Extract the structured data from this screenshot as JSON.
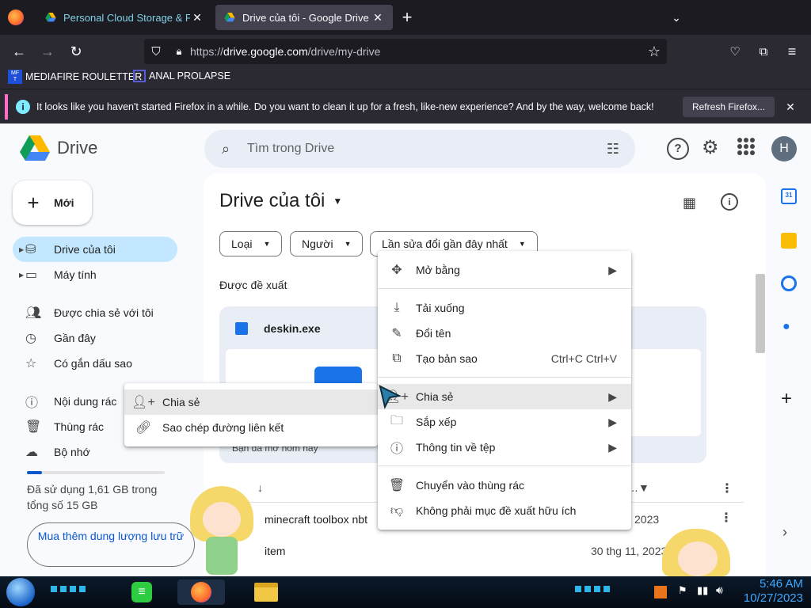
{
  "browser": {
    "tabs": [
      {
        "title": "Personal Cloud Storage & File S",
        "active": false
      },
      {
        "title": "Drive của tôi - Google Drive",
        "active": true
      }
    ],
    "url_prefix": "https://",
    "url_domain": "drive.google.com",
    "url_path": "/drive/my-drive",
    "bookmarks": [
      "MEDIAFIRE ROULETTER",
      "ANAL PROLAPSE"
    ],
    "bookmark_badge": "MF\nT",
    "notice_text": "It looks like you haven't started Firefox in a while. Do you want to clean it up for a fresh, like-new experience? And by the way, welcome back!",
    "notice_button": "Refresh Firefox..."
  },
  "drive": {
    "logo_text": "Drive",
    "search_placeholder": "Tìm trong Drive",
    "avatar_letter": "H",
    "new_button": "Mới",
    "sidebar": [
      {
        "label": "Drive của tôi",
        "icon": "drive-icon",
        "active": true,
        "expandable": true
      },
      {
        "label": "Máy tính",
        "icon": "computer-icon",
        "active": false,
        "expandable": true
      },
      {
        "label": "Được chia sẻ với tôi",
        "icon": "people-icon",
        "active": false
      },
      {
        "label": "Gần đây",
        "icon": "clock-icon",
        "active": false
      },
      {
        "label": "Có gắn dấu sao",
        "icon": "star-icon",
        "active": false
      },
      {
        "label": "Nội dung rác",
        "icon": "spam-icon",
        "active": false
      },
      {
        "label": "Thùng rác",
        "icon": "trash-icon",
        "active": false
      },
      {
        "label": "Bộ nhớ",
        "icon": "cloud-icon",
        "active": false
      }
    ],
    "storage_text": "Đã sử dụng 1,61 GB trong tổng số 15 GB",
    "storage_fraction": 0.107,
    "buy_storage": "Mua thêm dung lượng lưu trữ",
    "page_title": "Drive của tôi",
    "filters": [
      "Loại",
      "Người",
      "Lần sửa đổi gần đây nhất"
    ],
    "suggested_label": "Được đề xuất",
    "suggested_file": "deskin.exe",
    "suggested_caption": "Bạn đã mở hôm nay",
    "files": [
      {
        "name": "minecraft toolbox nbt",
        "date": "2023"
      },
      {
        "name": "item",
        "date": "30 thg 11, 2023"
      }
    ]
  },
  "context_menu": {
    "items": [
      {
        "label": "Mở bằng",
        "icon": "move-icon",
        "submenu": true
      },
      {
        "label": "Tải xuống",
        "icon": "download-icon"
      },
      {
        "label": "Đổi tên",
        "icon": "edit-icon"
      },
      {
        "label": "Tạo bản sao",
        "icon": "copy-icon",
        "shortcut": "Ctrl+C Ctrl+V"
      },
      {
        "label": "Chia sẻ",
        "icon": "person-add-icon",
        "submenu": true,
        "highlighted": true
      },
      {
        "label": "Sắp xếp",
        "icon": "folder-move-icon",
        "submenu": true
      },
      {
        "label": "Thông tin về tệp",
        "icon": "info-icon",
        "submenu": true
      },
      {
        "label": "Chuyển vào thùng rác",
        "icon": "trash-icon"
      },
      {
        "label": "Không phải mục đề xuất hữu ích",
        "icon": "thumb-down-icon"
      }
    ]
  },
  "share_submenu": {
    "items": [
      {
        "label": "Chia sẻ",
        "icon": "person-add-icon",
        "highlighted": true
      },
      {
        "label": "Sao chép đường liên kết",
        "icon": "link-icon"
      }
    ]
  },
  "taskbar": {
    "time": "5:46 AM",
    "date": "10/27/2023"
  },
  "colors": {
    "drive_bg": "#f8fafd",
    "active_nav": "#c2e7ff",
    "hover_menu": "#e8e8e8",
    "clock": "#3ea8ff"
  }
}
